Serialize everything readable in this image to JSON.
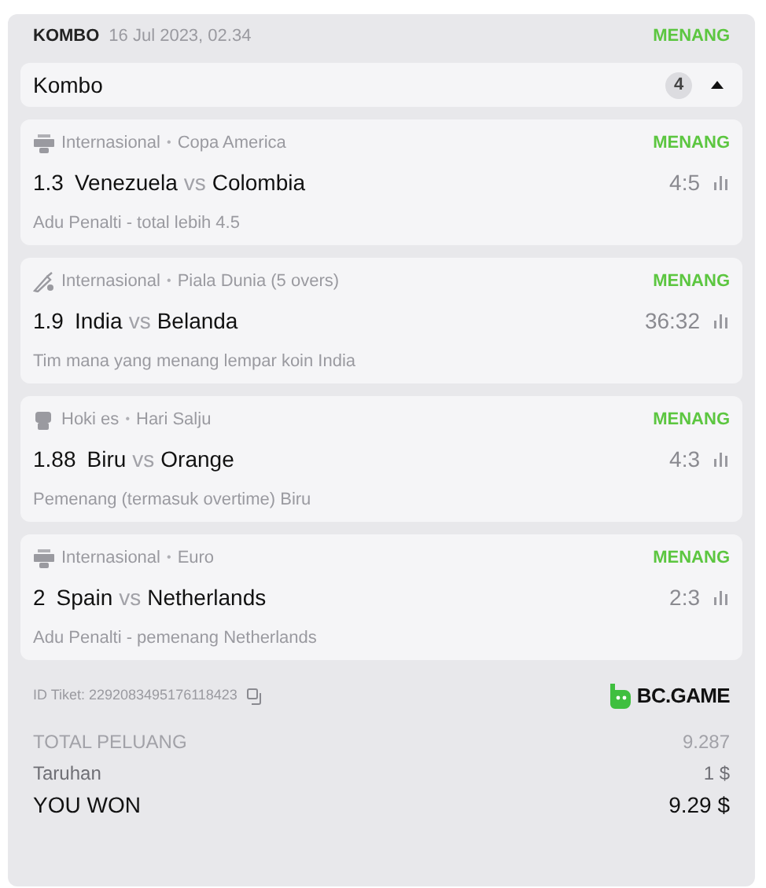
{
  "header": {
    "type": "KOMBO",
    "date": "16 Jul 2023, 02.34",
    "status": "MENANG"
  },
  "kombo": {
    "title": "Kombo",
    "count": "4",
    "expanded": true
  },
  "events": [
    {
      "kind": "fifa",
      "league": "Internasional",
      "separator": "•",
      "tournament": "Copa America",
      "status": "MENANG",
      "odds": "1.3",
      "home": "Venezuela",
      "vs": "vs",
      "away": "Colombia",
      "score": "4:5",
      "market": "Adu Penalti - total lebih 4.5"
    },
    {
      "kind": "cricket",
      "league": "Internasional",
      "separator": "•",
      "tournament": "Piala Dunia (5 overs)",
      "status": "MENANG",
      "odds": "1.9",
      "home": "India",
      "vs": "vs",
      "away": "Belanda",
      "score": "36:32",
      "market": "Tim mana yang menang lempar koin India"
    },
    {
      "kind": "hockey",
      "league": "Hoki es",
      "separator": "•",
      "tournament": "Hari Salju",
      "status": "MENANG",
      "odds": "1.88",
      "home": "Biru",
      "vs": "vs",
      "away": "Orange",
      "score": "4:3",
      "market": "Pemenang (termasuk overtime) Biru"
    },
    {
      "kind": "fifa",
      "league": "Internasional",
      "separator": "•",
      "tournament": "Euro",
      "status": "MENANG",
      "odds": "2",
      "home": "Spain",
      "vs": "vs",
      "away": "Netherlands",
      "score": "2:3",
      "market": "Adu Penalti - pemenang Netherlands"
    }
  ],
  "ticket": {
    "label": "ID Tiket: 2292083495176118423",
    "brand": "BC.GAME"
  },
  "totals": [
    {
      "kind": "muted",
      "label": "TOTAL PELUANG",
      "value": "9.287"
    },
    {
      "kind": "normal",
      "label": "Taruhan",
      "value": "1 $"
    },
    {
      "kind": "result",
      "label": "YOU WON",
      "value": "9.29 $"
    }
  ]
}
